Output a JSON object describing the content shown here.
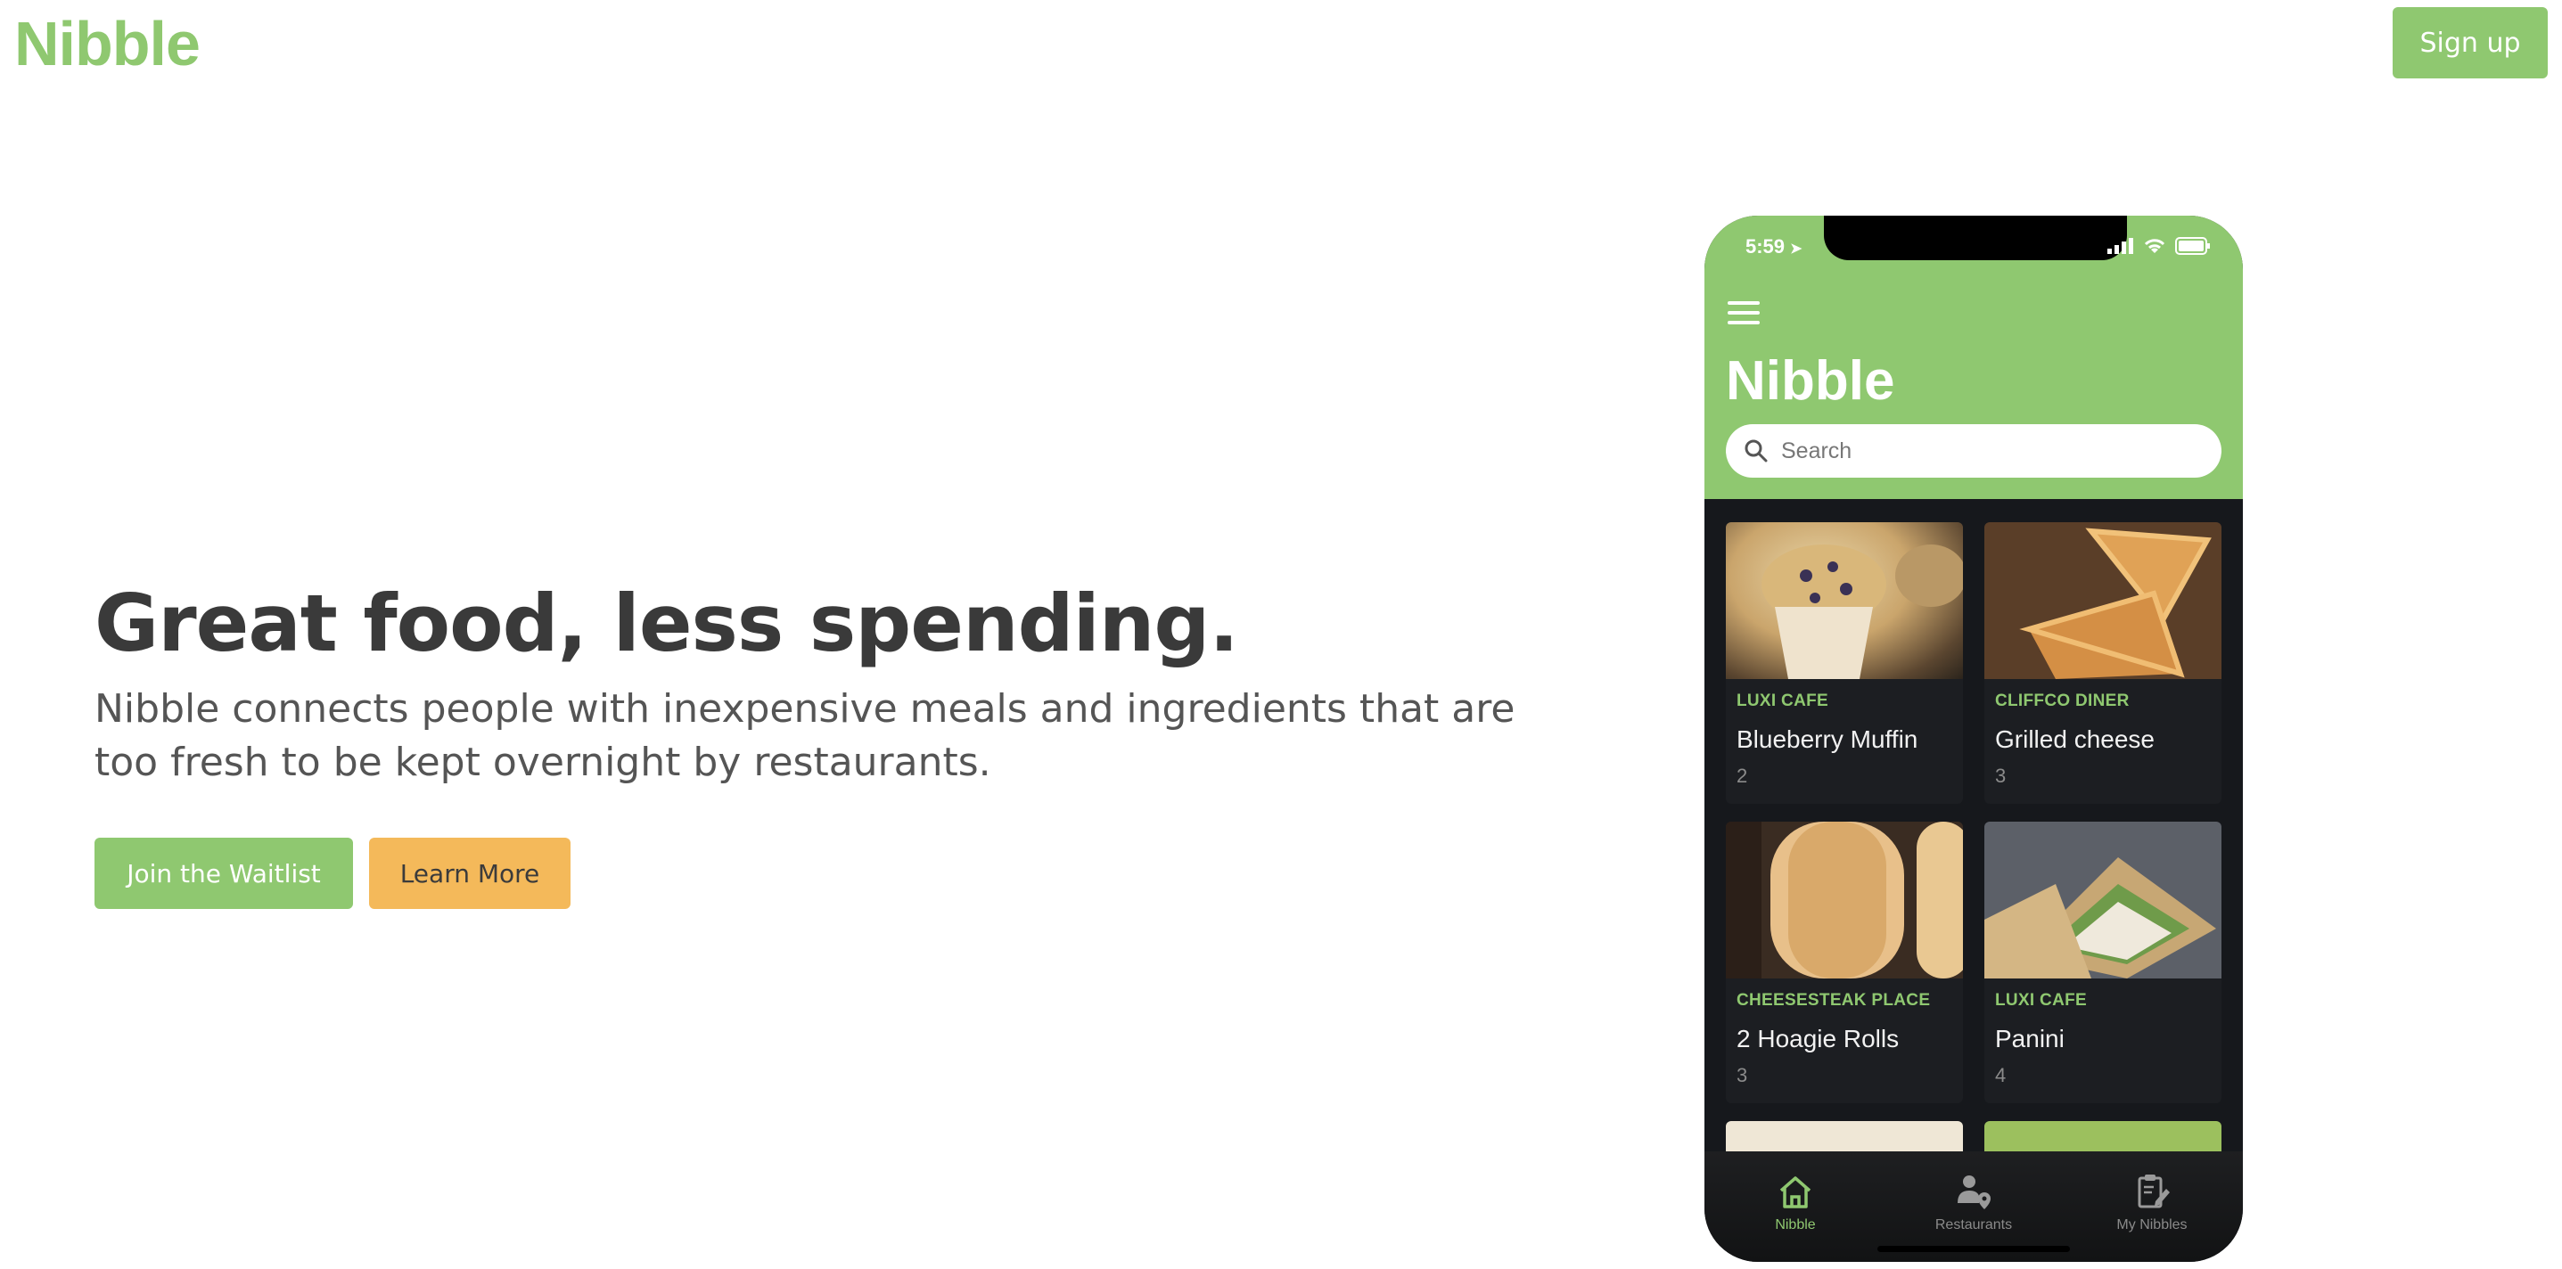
{
  "site": {
    "logo": "Nibble",
    "signup_label": "Sign up"
  },
  "hero": {
    "headline": "Great food, less spending.",
    "description": "Nibble connects people with inexpensive meals and ingredients that are too fresh to be kept overnight by restaurants.",
    "cta_primary": "Join the Waitlist",
    "cta_secondary": "Learn More"
  },
  "phone": {
    "status_time": "5:59",
    "app_title": "Nibble",
    "search_placeholder": "Search",
    "items": [
      {
        "restaurant": "LUXI CAFE",
        "name": "Blueberry Muffin",
        "quantity": "2"
      },
      {
        "restaurant": "CLIFFCO DINER",
        "name": "Grilled cheese",
        "quantity": "3"
      },
      {
        "restaurant": "CHEESESTEAK PLACE",
        "name": "2 Hoagie Rolls",
        "quantity": "3"
      },
      {
        "restaurant": "LUXI CAFE",
        "name": "Panini",
        "quantity": "4"
      }
    ],
    "tabs": [
      {
        "label": "Nibble",
        "icon": "home-icon",
        "active": true
      },
      {
        "label": "Restaurants",
        "icon": "person-location-icon",
        "active": false
      },
      {
        "label": "My Nibbles",
        "icon": "clipboard-edit-icon",
        "active": false
      }
    ]
  },
  "colors": {
    "brand_green": "#8fc870",
    "accent_yellow": "#f4b95a",
    "app_dark": "#16181c"
  }
}
